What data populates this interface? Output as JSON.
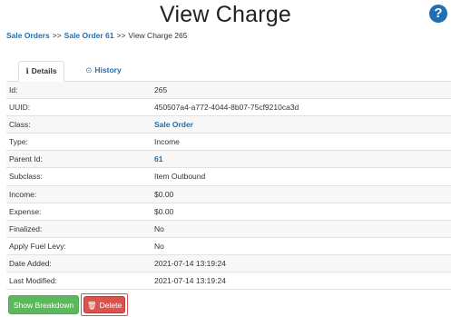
{
  "page_title": "View Charge",
  "help_icon": "?",
  "breadcrumb": {
    "item1": "Sale Orders",
    "sep1": ">>",
    "item2": "Sale Order 61",
    "sep2": ">>",
    "current": "View Charge 265"
  },
  "tabs": {
    "details": {
      "icon": "ℹ",
      "label": "Details"
    },
    "history": {
      "icon": "⊙",
      "label": "History"
    }
  },
  "rows": [
    {
      "label": "Id:",
      "value": "265",
      "link": false
    },
    {
      "label": "UUID:",
      "value": "450507a4-a772-4044-8b07-75cf9210ca3d",
      "link": false
    },
    {
      "label": "Class:",
      "value": "Sale Order",
      "link": true
    },
    {
      "label": "Type:",
      "value": "Income",
      "link": false
    },
    {
      "label": "Parent Id:",
      "value": "61",
      "link": true
    },
    {
      "label": "Subclass:",
      "value": "Item Outbound",
      "link": false
    },
    {
      "label": "Income:",
      "value": "$0.00",
      "link": false
    },
    {
      "label": "Expense:",
      "value": "$0.00",
      "link": false
    },
    {
      "label": "Finalized:",
      "value": "No",
      "link": false
    },
    {
      "label": "Apply Fuel Levy:",
      "value": "No",
      "link": false
    },
    {
      "label": "Date Added:",
      "value": "2021-07-14 13:19:24",
      "link": false
    },
    {
      "label": "Last Modified:",
      "value": "2021-07-14 13:19:24",
      "link": false
    }
  ],
  "buttons": {
    "show_breakdown": "Show Breakdown",
    "delete": "Delete",
    "delete_icon": "🗑"
  },
  "colors": {
    "link": "#1f6fb2",
    "success": "#5cb85c",
    "danger": "#d9534f"
  }
}
